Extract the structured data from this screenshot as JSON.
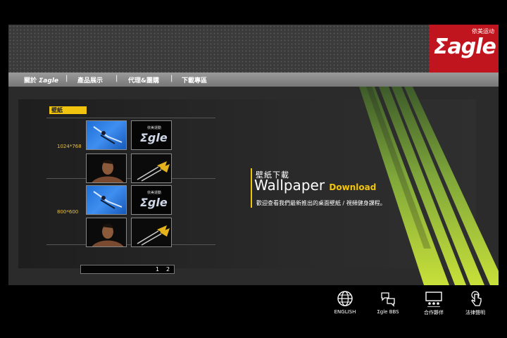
{
  "logo": {
    "brand": "Σagle",
    "cn": "依美运动"
  },
  "nav": [
    {
      "label": "關於"
    },
    {
      "label": "產品展示"
    },
    {
      "label": "代理&團購"
    },
    {
      "label": "下載專區"
    }
  ],
  "nav_logo": "Σagle",
  "nav_separator": "|",
  "section": {
    "title": "壁紙"
  },
  "groups": [
    {
      "size": "1024*768"
    },
    {
      "size": "800*600"
    }
  ],
  "thumb_logo": {
    "cn": "依美運動",
    "brand": "Σgle"
  },
  "pager": [
    "1",
    "2"
  ],
  "wallpaper": {
    "heading_cn": "壁紙下載",
    "title": "Wallpaper",
    "subtitle": "Download",
    "description": "歡迎查看我們最新推出的桌面壁紙 / 視頻健身課程。"
  },
  "footer": [
    {
      "label": "ENGLISH",
      "icon": "globe-icon"
    },
    {
      "label": "Σgle BBS",
      "icon": "chat-icon"
    },
    {
      "label": "合作夥伴",
      "icon": "partners-icon"
    },
    {
      "label": "法律聲明",
      "icon": "touch-icon"
    }
  ],
  "colors": {
    "accent": "#f1c40f",
    "brand": "#c0151e",
    "stripe_green": "#b5d334"
  }
}
